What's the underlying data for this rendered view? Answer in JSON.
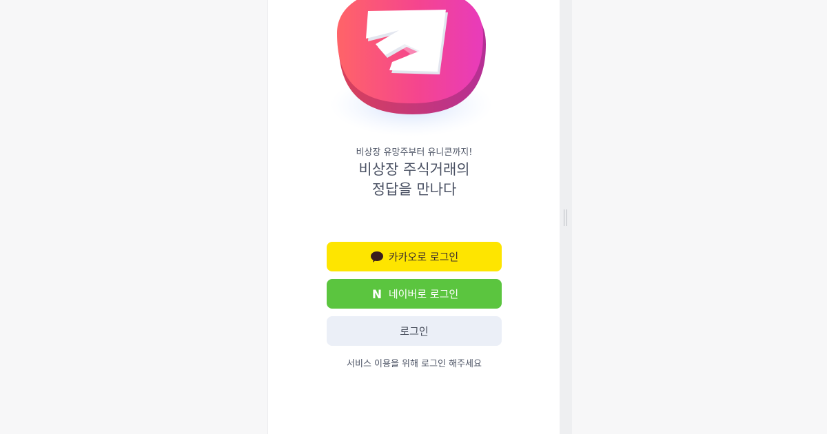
{
  "hero": {
    "tagline": "비상장 유망주부터 유니콘까지!",
    "headline_line1": "비상장 주식거래의",
    "headline_line2": "정답을 만나다"
  },
  "auth": {
    "kakao_label": "카카오로 로그인",
    "naver_label": "네이버로 로그인",
    "naver_icon_letter": "N",
    "login_label": "로그인",
    "notice": "서비스 이용을 위해 로그인 해주세요"
  },
  "colors": {
    "kakao": "#fee500",
    "naver": "#5bc53f",
    "login": "#ebeff7",
    "logo_gradient_start": "#ff5e6e",
    "logo_gradient_end": "#e83ab8"
  },
  "icons": {
    "logo": "app-logo-arrow",
    "kakao": "speech-bubble-icon",
    "naver": "naver-n-icon",
    "resize": "resize-handle-icon"
  }
}
